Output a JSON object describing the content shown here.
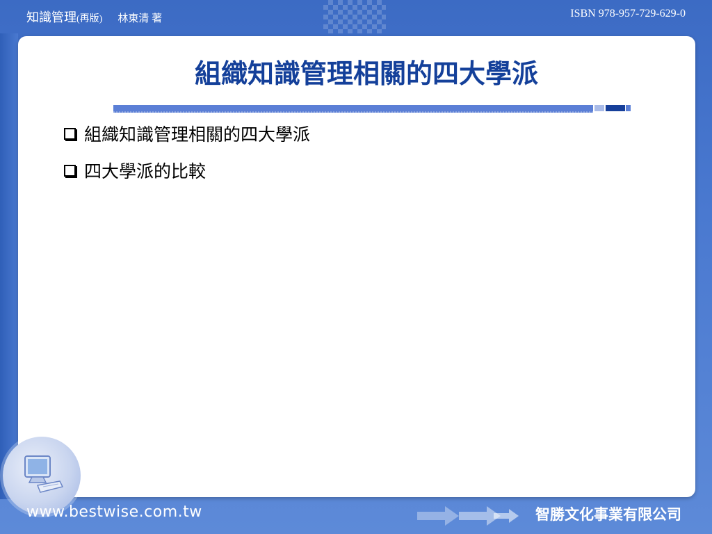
{
  "header": {
    "book_title": "知識管理",
    "edition": "(再版)",
    "author": "林東清 著",
    "isbn": "ISBN 978-957-729-629-0"
  },
  "slide": {
    "title": "組織知識管理相關的四大學派",
    "bullets": [
      {
        "text": "組織知識管理相關的四大學派"
      },
      {
        "text": "四大學派的比較"
      }
    ]
  },
  "footer": {
    "website": "www.bestwise.com.tw",
    "publisher": "智勝文化事業有限公司"
  },
  "colors": {
    "title": "#14409a",
    "frame": "#4a74c9"
  },
  "icons": {
    "bullet": "checkbox-bullet-icon",
    "badge": "computer-monitor-icon",
    "arrows": "arrow-icon"
  }
}
